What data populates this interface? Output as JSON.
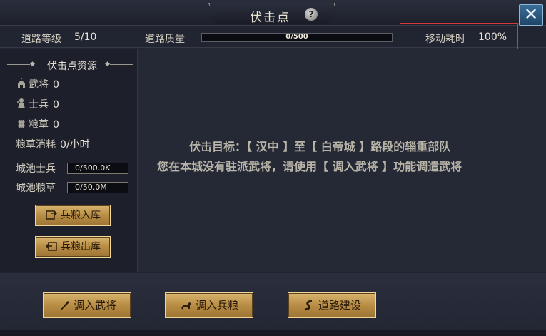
{
  "window": {
    "title": "伏击点",
    "help_icon": "?",
    "close_icon": "✕"
  },
  "status": {
    "road_level_label": "道路等级",
    "road_level_value": "5/10",
    "road_quality_label": "道路质量",
    "road_quality_text": "0/500",
    "road_quality_progress": 0.0,
    "move_cost_label": "移动耗时",
    "move_cost_value": "100%"
  },
  "resources": {
    "header": "伏击点资源",
    "general_label": "武将",
    "general_value": "0",
    "soldier_label": "士兵",
    "soldier_value": "0",
    "grain_label": "粮草",
    "grain_value": "0",
    "grain_consume_label": "粮草消耗",
    "grain_consume_value": "0/小时",
    "city_soldier_label": "城池士兵",
    "city_soldier_value": "0/500.0K",
    "city_grain_label": "城池粮草",
    "city_grain_value": "0/50.0M",
    "deposit_button": "兵粮入库",
    "withdraw_button": "兵粮出库"
  },
  "main": {
    "message_line1": "伏击目标：【 汉中 】至【 白帝城 】路段的辎重部队",
    "message_line2": "您在本城没有驻派武将，请使用【 调入武将 】功能调遣武将"
  },
  "actions": {
    "transfer_general": "调入武将",
    "transfer_grain": "调入兵粮",
    "road_build": "道路建设"
  },
  "colors": {
    "accent_gold": "#c9a35c",
    "highlight_red": "#d43a3a",
    "close_blue": "#2f5f88"
  }
}
